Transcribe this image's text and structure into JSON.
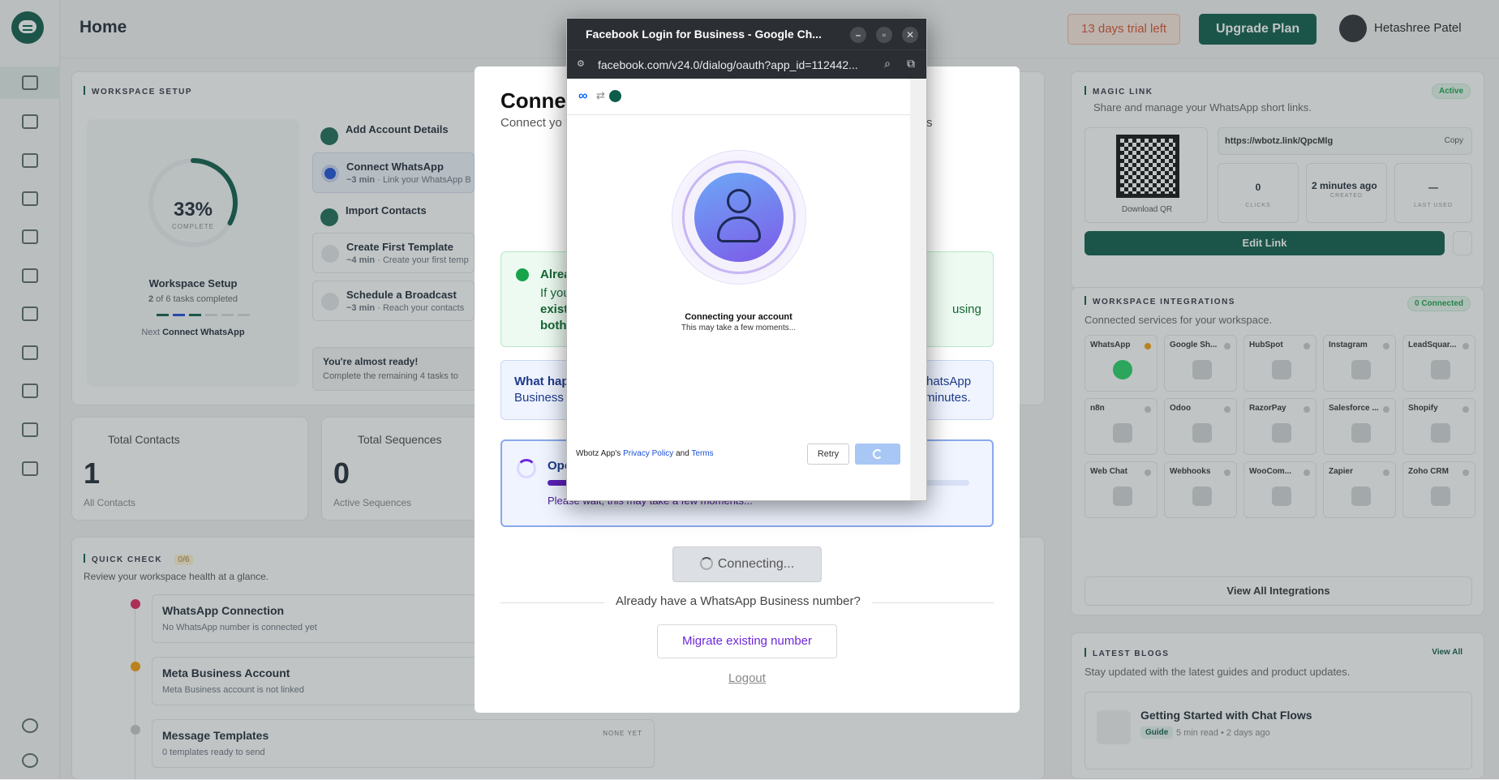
{
  "header": {
    "title": "Home",
    "trial": "13 days trial left",
    "upgrade": "Upgrade Plan",
    "user": "Hetashree Patel"
  },
  "setup": {
    "section": "WORKSPACE SETUP",
    "percent": "33%",
    "complete": "COMPLETE",
    "progress_fraction": 0.33,
    "title": "Workspace Setup",
    "tasks_done": "2",
    "tasks_text": "of 6 tasks completed",
    "next_label": "Next",
    "next_value": "Connect WhatsApp",
    "tasks": [
      {
        "title": "Add Account Details",
        "sub": ""
      },
      {
        "title": "Connect WhatsApp",
        "dur": "~3 min",
        "sub": "· Link your WhatsApp B"
      },
      {
        "title": "Import Contacts",
        "sub": ""
      },
      {
        "title": "Create First Template",
        "dur": "~4 min",
        "sub": "· Create your first temp"
      },
      {
        "title": "Schedule a Broadcast",
        "dur": "~3 min",
        "sub": "· Reach your contacts"
      }
    ],
    "ready_title": "You're almost ready!",
    "ready_sub": "Complete the remaining 4 tasks to"
  },
  "stats": [
    {
      "label": "Total Contacts",
      "value": "1",
      "sub": "All Contacts"
    },
    {
      "label": "Total Sequences",
      "value": "0",
      "sub": "Active Sequences"
    }
  ],
  "quick": {
    "section": "QUICK CHECK",
    "badge": "0/6",
    "sub": "Review your workspace health at a glance.",
    "items": [
      {
        "title": "WhatsApp Connection",
        "sub": "No WhatsApp number is connected yet",
        "color": "#e0245e"
      },
      {
        "title": "Meta Business Account",
        "sub": "Meta Business account is not linked",
        "color": "#f59e0b"
      },
      {
        "title": "Message Templates",
        "sub": "0 templates ready to send",
        "color": "#c7c9cc",
        "tag": "NONE YET"
      }
    ]
  },
  "magic": {
    "section": "MAGIC LINK",
    "status": "Active",
    "sub": "Share and manage your WhatsApp short links.",
    "url": "https://wbotz.link/QpcMlg",
    "copy": "Copy",
    "download": "Download QR",
    "stats": [
      {
        "v": "0",
        "l": "CLICKS"
      },
      {
        "v": "2 minutes ago",
        "l": "CREATED"
      },
      {
        "v": "—",
        "l": "LAST USED"
      }
    ],
    "edit": "Edit Link"
  },
  "integrations": {
    "section": "WORKSPACE INTEGRATIONS",
    "status": "0 Connected",
    "sub": "Connected services for your workspace.",
    "items": [
      "WhatsApp",
      "Google Sh...",
      "HubSpot",
      "Instagram",
      "LeadSquar...",
      "n8n",
      "Odoo",
      "RazorPay",
      "Salesforce ...",
      "Shopify",
      "Web Chat",
      "Webhooks",
      "WooCom...",
      "Zapier",
      "Zoho CRM"
    ],
    "view_all": "View All Integrations"
  },
  "blogs": {
    "section": "LATEST BLOGS",
    "view_all": "View All",
    "sub": "Stay updated with the latest guides and product updates.",
    "post_title": "Getting Started with Chat Flows",
    "tag": "Guide",
    "meta": "5 min read • 2 days ago"
  },
  "modal": {
    "title": "Conne",
    "sub_left": "Connect yo",
    "sub_right": "s",
    "already_title": "Alrea",
    "already_lines": [
      "If you",
      "exist",
      "both"
    ],
    "already_right": "using",
    "what_title": "What hap",
    "what_sub": "Business",
    "what_right1": "hatsApp",
    "what_right2": "minutes.",
    "open_title": "Ope",
    "open_sub": "Please wait, this may take a few moments...",
    "connecting": "Connecting...",
    "divider": "Already have a WhatsApp Business number?",
    "migrate": "Migrate existing number",
    "logout": "Logout"
  },
  "popup": {
    "window_title": "Facebook Login for Business - Google Ch...",
    "url": "facebook.com/v24.0/dialog/oauth?app_id=112442...",
    "connecting_title": "Connecting your account",
    "connecting_sub": "This may take a few moments...",
    "footer_prefix": "Wbotz App's",
    "privacy": "Privacy Policy",
    "and": "and",
    "terms": "Terms",
    "retry": "Retry"
  }
}
